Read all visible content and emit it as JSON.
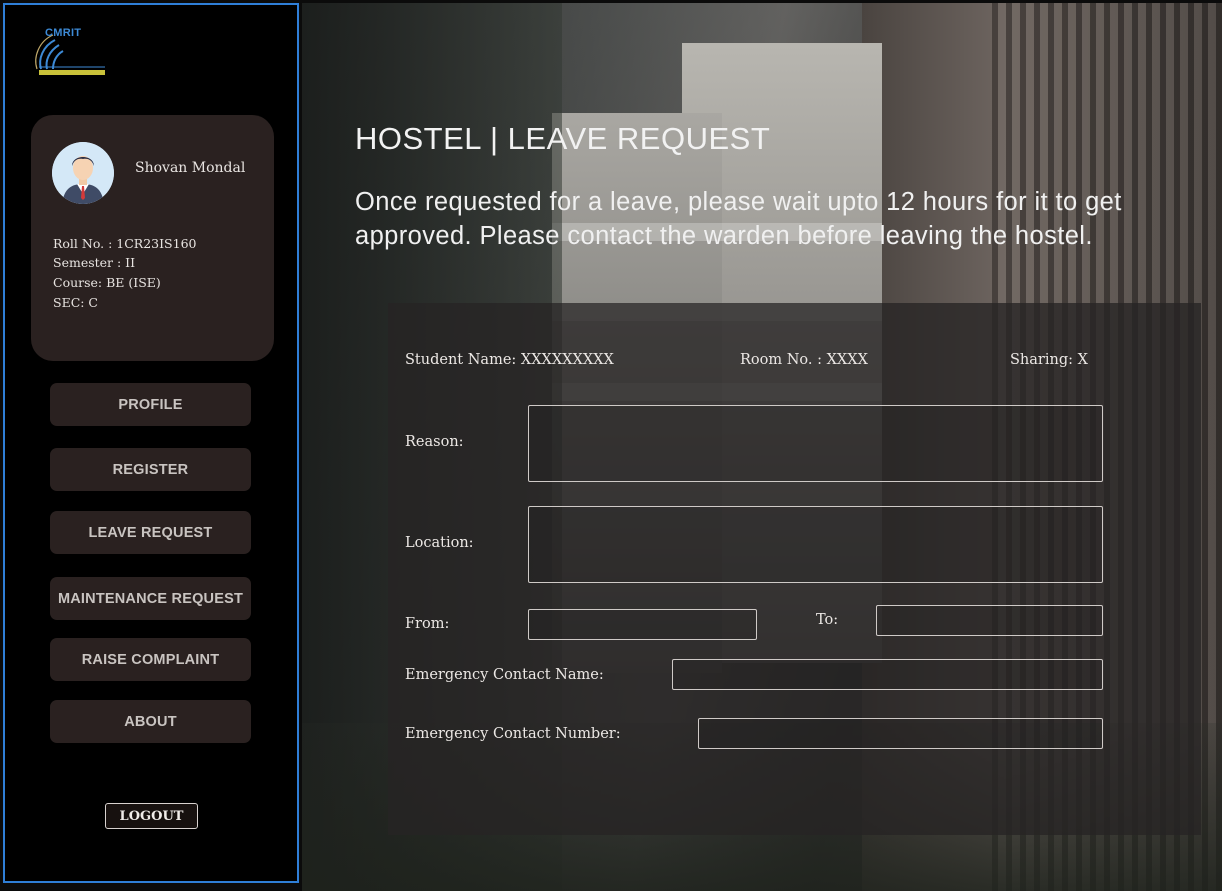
{
  "sidebar": {
    "logo_text": "CMRIT",
    "user": {
      "name": "Shovan Mondal",
      "roll": "Roll No. : 1CR23IS160",
      "semester": "Semester : II",
      "course": "Course: BE (ISE)",
      "section": "SEC: C"
    },
    "nav": [
      {
        "label": "PROFILE"
      },
      {
        "label": "REGISTER"
      },
      {
        "label": "LEAVE REQUEST"
      },
      {
        "label": "MAINTENANCE REQUEST"
      },
      {
        "label": "RAISE COMPLAINT"
      },
      {
        "label": "ABOUT"
      }
    ],
    "logout_label": "LOGOUT"
  },
  "main": {
    "title": "HOSTEL | LEAVE REQUEST",
    "note": "Once requested for a leave, please wait upto 12 hours for it to get approved. Please contact the warden before leaving the hostel.",
    "form": {
      "student_name": "Student Name:  XXXXXXXXX",
      "room_no": "Room No. : XXXX",
      "sharing": "Sharing: X",
      "reason_label": "Reason:",
      "location_label": "Location:",
      "from_label": "From:",
      "to_label": "To:",
      "emergency_name_label": "Emergency Contact Name:",
      "emergency_number_label": "Emergency Contact Number:"
    }
  },
  "colors": {
    "sidebar_bg": "#000000",
    "card_bg": "#2a2120",
    "accent_border": "#2f7fd8"
  }
}
